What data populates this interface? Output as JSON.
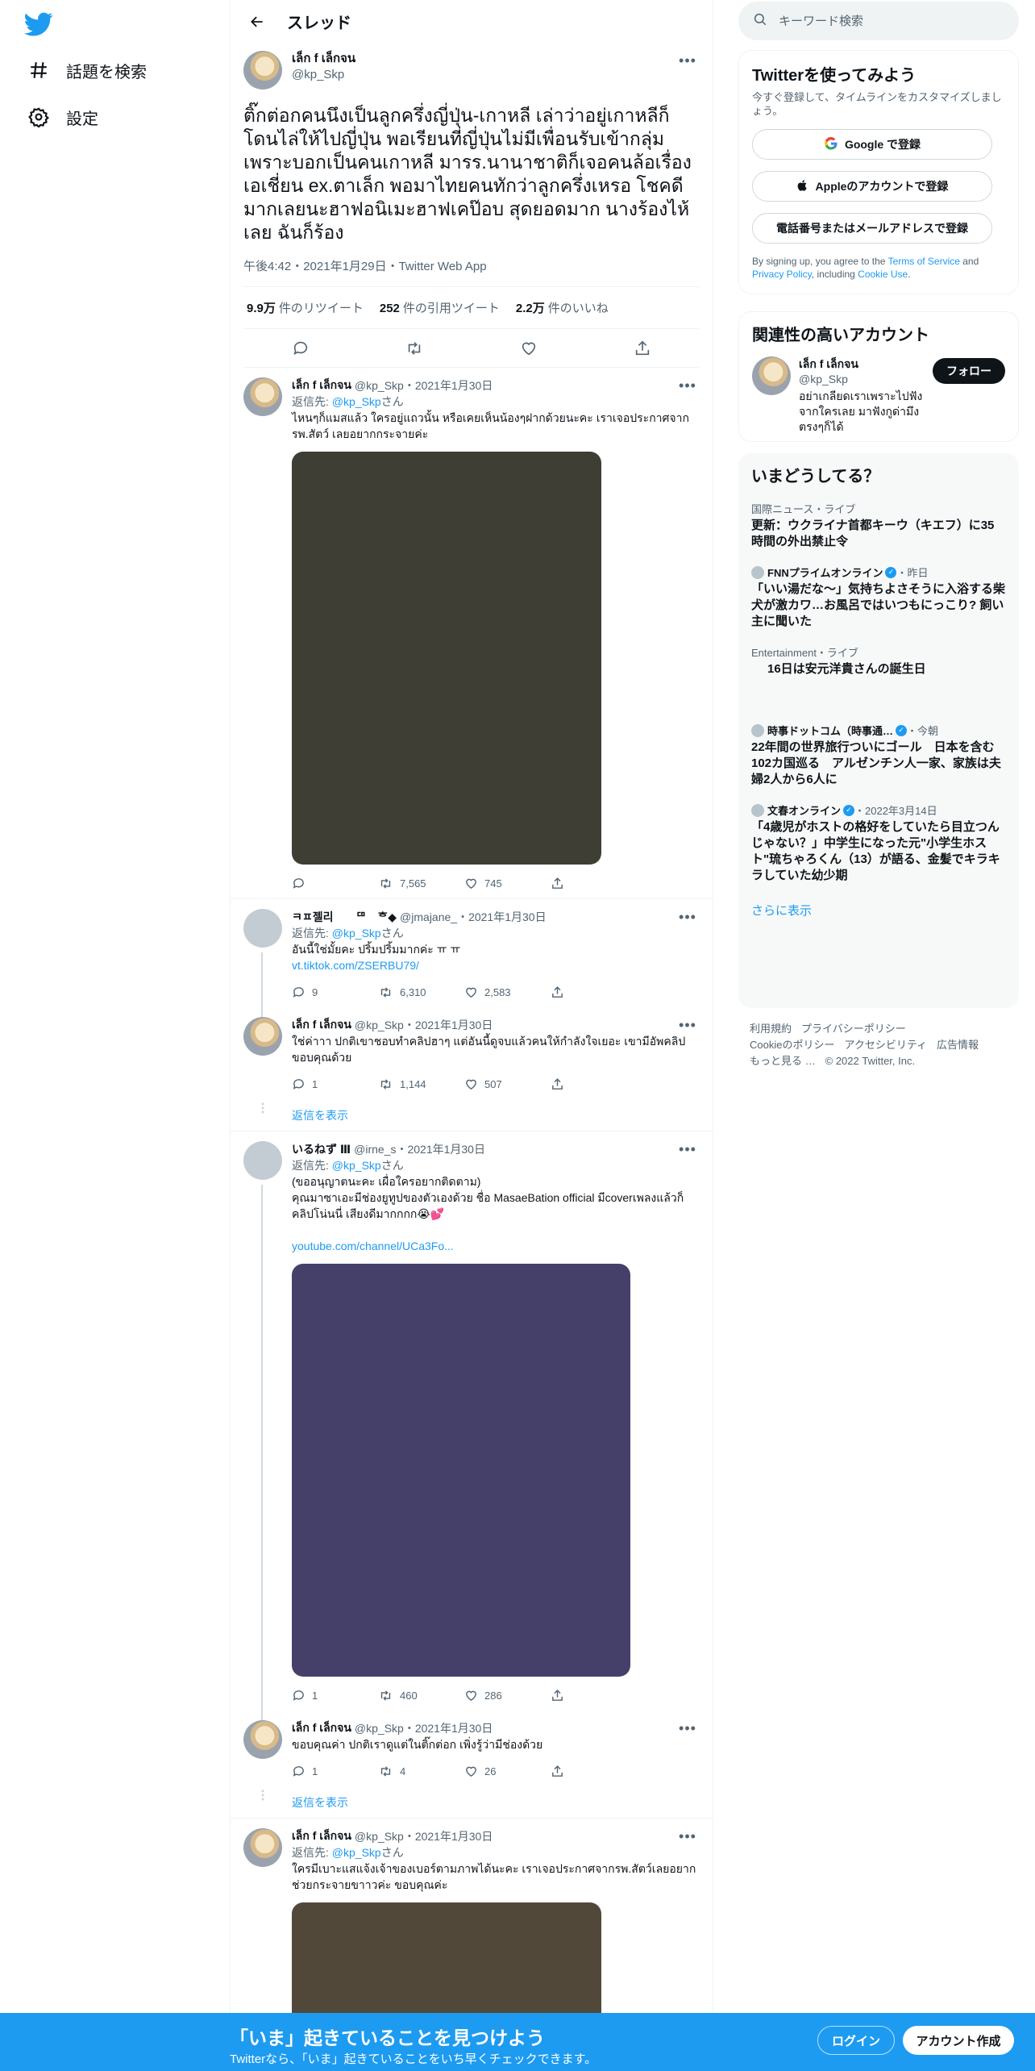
{
  "nav": {
    "explore_label": "話題を検索",
    "settings_label": "設定"
  },
  "header": {
    "title": "スレッド"
  },
  "focal_tweet": {
    "name": "เล็ก f เล็กจน",
    "handle": "@kp_Skp",
    "text": "ติ๊กต่อกคนนึงเป็นลูกครึ่งญี่ปุ่น-เกาหลี เล่าว่าอยู่เกาหลีก็โดนไล่ให้ไปญี่ปุ่น พอเรียนที่ญี่ปุ่นไม่มีเพื่อนรับเข้ากลุ่มเพราะบอกเป็นคนเกาหลี มารร.นานาชาติก็เจอคนล้อเรื่องเอเชี่ยน ex.ตาเล็ก พอมาไทยคนทักว่าลูกครึ่งเหรอ โชคดีมากเลยนะฮาฟอนิเมะฮาฟเคป๊อบ สุดยอดมาก นางร้องไห้เลย ฉันก็ร้อง",
    "meta": "午後4:42・2021年1月29日・Twitter Web App",
    "retweets_count": "9.9万",
    "retweets_label": "件のリツイート",
    "quotes_count": "252",
    "quotes_label": "件の引用ツイート",
    "likes_count": "2.2万",
    "likes_label": "件のいいね"
  },
  "replies": [
    {
      "name": "เล็ก f เล็กจน",
      "meta": "@kp_Skp・2021年1月30日",
      "replying_prefix": "返信先: ",
      "replying_handle": "@kp_Skp",
      "replying_suffix": "さん",
      "text": "ไหนๆก็แมสแล้ว ใครอยู่แถวนั้น หรือเคยเห็นน้องๆฝากด้วยนะคะ เราเจอประกาศจากรพ.สัตว์ เลยอยากกระจายค่ะ",
      "replies": "",
      "retweets": "7,565",
      "likes": "745",
      "media_color": "#3e3e34"
    },
    {
      "name": "ㅋㅍ젤리　　ᄃᄆ　ᄒ◆",
      "meta": "@jmajane_・2021年1月30日",
      "replying_prefix": "返信先: ",
      "replying_handle": "@kp_Skp",
      "replying_suffix": "さん",
      "text": "อันนี้ใช่มั้ยคะ ปริ้มปริ้มมากค่ะ ㅠ ㅠ",
      "link": "vt.tiktok.com/ZSERBU79/",
      "replies": "9",
      "retweets": "6,310",
      "likes": "2,583"
    },
    {
      "name": "เล็ก f เล็กจน",
      "meta": "@kp_Skp・2021年1月30日",
      "text": "ใช่ค่าาา ปกติเขาชอบทำคลิปฮาๆ แต่อันนี้ดูจบแล้วคนให้กำลังใจเยอะ เขามีอัพคลิปขอบคุณด้วย",
      "replies": "1",
      "retweets": "1,144",
      "likes": "507"
    },
    {
      "name": "いるねず Ⅲ",
      "meta": "@irne_s・2021年1月30日",
      "replying_prefix": "返信先: ",
      "replying_handle": "@kp_Skp",
      "replying_suffix": "さん",
      "text": "(ขออนุญาตนะคะ เผื่อใครอยากติดตาม)\nคุณมาซาเอะมีช่องยูทูปของตัวเองด้วย ชื่อ MasaeBation official มีcoverเพลงแล้วก็คลิปโน่นนี่ เสียงดีมากกกก😭💕",
      "link": "youtube.com/channel/UCa3Fo...",
      "replies": "1",
      "retweets": "460",
      "likes": "286",
      "media_color": "#45406a"
    },
    {
      "name": "เล็ก f เล็กจน",
      "meta": "@kp_Skp・2021年1月30日",
      "text": "ขอบคุณค่า ปกติเราดูแต่ในติ๊กต่อก เพิ่งรู้ว่ามีช่องด้วย",
      "replies": "1",
      "retweets": "4",
      "likes": "26"
    },
    {
      "name": "เล็ก f เล็กจน",
      "meta": "@kp_Skp・2021年1月30日",
      "replying_prefix": "返信先: ",
      "replying_handle": "@kp_Skp",
      "replying_suffix": "さん",
      "text": "ใครมีเบาะแสแจ้งเจ้าของเบอร์ตามภาพได้นะคะ เราเจอประกาศจากรพ.สัตว์เลยอยากช่วยกระจายขาาวค่ะ ขอบคุณค่ะ",
      "media_color": "#52483a"
    }
  ],
  "show_replies_label": "返信を表示",
  "search": {
    "placeholder": "キーワード検索"
  },
  "signup_box": {
    "title": "Twitterを使ってみよう",
    "subtitle": "今すぐ登録して、タイムラインをカスタマイズしましょう。",
    "google_label": "Google で登録",
    "apple_label": "Appleのアカウントで登録",
    "phone_label": "電話番号またはメールアドレスで登録",
    "legal_prefix": "By signing up, you agree to the ",
    "terms_link": "Terms of Service",
    "legal_and": " and ",
    "privacy_link": "Privacy Policy",
    "legal_including": ", including ",
    "cookie_link": "Cookie Use",
    "legal_end": "."
  },
  "related": {
    "title": "関連性の高いアカウント",
    "name": "เล็ก f เล็กจน",
    "handle": "@kp_Skp",
    "bio": "อย่าเกลียดเราเพราะไปฟังจากใครเลย มาฟังกูด่ามึงตรงๆก็ได้",
    "follow_label": "フォロー"
  },
  "trends": {
    "title": "いまどうしてる？",
    "items": [
      {
        "category": "国際ニュース・ライブ",
        "title": "更新：ウクライナ首都キーウ（キエフ）に35時間の外出禁止令"
      },
      {
        "source": "FNNプライムオンライン",
        "time": "・昨日",
        "title": "「いい湯だな～」気持ちよさそうに入浴する柴犬が激カワ…お風呂ではいつもにっこり? 飼い主に聞いた"
      },
      {
        "category": "Entertainment・ライブ",
        "title": "16日は安元洋貴さんの誕生日"
      },
      {
        "source": "時事ドットコム（時事通…",
        "time": "・今朝",
        "title": "22年間の世界旅行ついにゴール　日本を含む102カ国巡る　アルゼンチン人一家、家族は夫婦2人から6人に"
      },
      {
        "source": "文春オンライン",
        "time": "・2022年3月14日",
        "title": "「4歳児がホストの格好をしていたら目立つんじゃない？」中学生になった元\"小学生ホスト\"琉ちゃろくん（13）が語る、金髪でキラキラしていた幼少期"
      }
    ],
    "show_more": "さらに表示"
  },
  "footer": {
    "terms": "利用規約",
    "privacy": "プライバシーポリシー",
    "cookie": "Cookieのポリシー",
    "accessibility": "アクセシビリティ",
    "ads": "広告情報",
    "more": "もっと見る …",
    "copyright": "© 2022 Twitter, Inc."
  },
  "bottom_bar": {
    "title": "「いま」起きていることを見つけよう",
    "subtitle": "Twitterなら、「いま」起きていることをいち早くチェックできます。",
    "login_label": "ログイン",
    "signup_label": "アカウント作成"
  },
  "colors": {
    "accent": "#1d9bf0",
    "text": "#0f1419",
    "muted": "#536471"
  }
}
